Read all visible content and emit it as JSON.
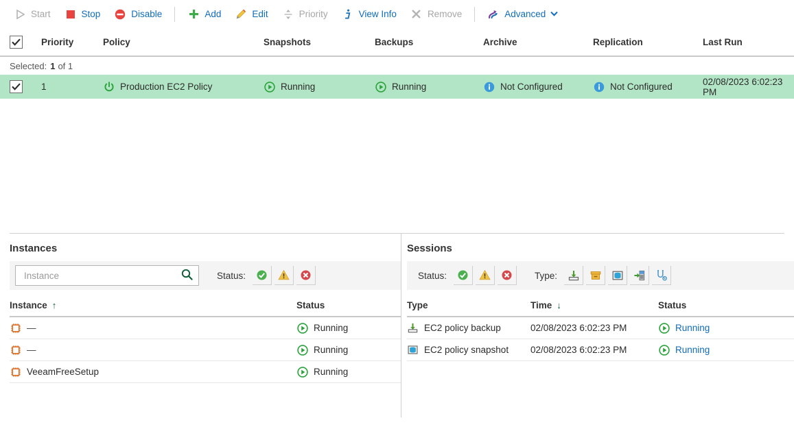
{
  "toolbar": {
    "items": [
      {
        "label": "Start",
        "icon": "play-icon",
        "enabled": false
      },
      {
        "label": "Stop",
        "icon": "stop-icon",
        "enabled": true
      },
      {
        "label": "Disable",
        "icon": "disable-icon",
        "enabled": true
      },
      {
        "label": "Add",
        "icon": "plus-icon",
        "enabled": true
      },
      {
        "label": "Edit",
        "icon": "pencil-icon",
        "enabled": true
      },
      {
        "label": "Priority",
        "icon": "priority-icon",
        "enabled": false
      },
      {
        "label": "View Info",
        "icon": "info-icon",
        "enabled": true
      },
      {
        "label": "Remove",
        "icon": "remove-icon",
        "enabled": false
      },
      {
        "label": "Advanced",
        "icon": "advanced-icon",
        "enabled": true,
        "caret": "❯"
      }
    ]
  },
  "policy_grid": {
    "columns": [
      "Priority",
      "Policy",
      "Snapshots",
      "Backups",
      "Archive",
      "Replication",
      "Last Run"
    ],
    "selected_label": "Selected:",
    "selected_count": "1",
    "selected_of": "of 1",
    "rows": [
      {
        "priority": "1",
        "policy": "Production EC2 Policy",
        "policy_icon": "power-icon",
        "snapshots": "Running",
        "snapshots_icon": "running-icon",
        "backups": "Running",
        "backups_icon": "running-icon",
        "archive": "Not Configured",
        "archive_icon": "info-circle-icon",
        "replication": "Not Configured",
        "replication_icon": "info-circle-icon",
        "last_run": "02/08/2023 6:02:23 PM"
      }
    ]
  },
  "instances_panel": {
    "title": "Instances",
    "search_placeholder": "Instance",
    "search_value": "",
    "search_icon": "search-icon",
    "status_label": "Status:",
    "status_filters": [
      "success-filter-icon",
      "warning-filter-icon",
      "error-filter-icon"
    ],
    "columns": [
      "Instance",
      "Status"
    ],
    "sort_arrow": "↑",
    "rows": [
      {
        "instance": "—",
        "icon": "ec2-instance-icon",
        "status": "Running",
        "status_icon": "running-icon"
      },
      {
        "instance": "—",
        "icon": "ec2-instance-icon",
        "status": "Running",
        "status_icon": "running-icon"
      },
      {
        "instance": "VeeamFreeSetup",
        "icon": "ec2-instance-icon",
        "status": "Running",
        "status_icon": "running-icon"
      }
    ]
  },
  "sessions_panel": {
    "title": "Sessions",
    "status_label": "Status:",
    "status_filters": [
      "success-filter-icon",
      "warning-filter-icon",
      "error-filter-icon"
    ],
    "type_label": "Type:",
    "type_filters": [
      "backup-type-icon",
      "archive-type-icon",
      "snapshot-type-icon",
      "restore-type-icon",
      "health-check-type-icon"
    ],
    "columns": [
      "Type",
      "Time",
      "Status"
    ],
    "sort_arrow": "↓",
    "rows": [
      {
        "type": "EC2 policy backup",
        "icon": "backup-type-icon",
        "time": "02/08/2023 6:02:23 PM",
        "status": "Running",
        "status_icon": "running-icon"
      },
      {
        "type": "EC2 policy snapshot",
        "icon": "snapshot-type-icon",
        "time": "02/08/2023 6:02:23 PM",
        "status": "Running",
        "status_icon": "running-icon"
      }
    ]
  },
  "colors": {
    "link": "#0f6cbd",
    "disabled": "#a6a6a6",
    "selected_row": "#b2e5c5",
    "success": "#3eac49",
    "warning": "#efc34a",
    "error": "#d6474b",
    "info": "#3b9ad9",
    "instance_orange": "#d96a20"
  }
}
